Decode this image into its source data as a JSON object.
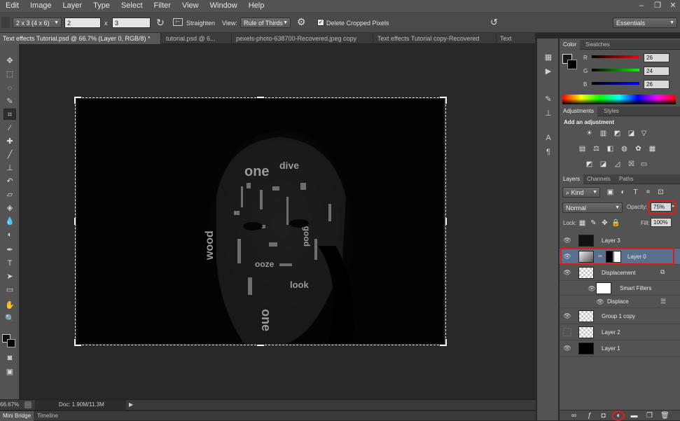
{
  "menu": [
    "Edit",
    "Image",
    "Layer",
    "Type",
    "Select",
    "Filter",
    "View",
    "Window",
    "Help"
  ],
  "options": {
    "ratio_preset": "2 x 3 (4 x 6)",
    "width_value": "2",
    "times_sign": "x",
    "height_value": "3",
    "straighten_label": "Straighten",
    "view_label": "View:",
    "view_value": "Rule of Thirds",
    "delete_cropped_label": "Delete Cropped Pixels",
    "delete_cropped_checked": true,
    "workspace_value": "Essentials"
  },
  "tabs": [
    "Text effects Tutorial.psd @ 66.7% (Layer 0, RGB/8) *",
    "tutorial.psd @ 6...",
    "pexels-photo-638700-Recovered.jpeg copy",
    "Text effects Tutorial copy-Recovered",
    "Text"
  ],
  "artwork_words": [
    "one",
    "wood",
    "dive",
    "look",
    "ooze",
    "agood",
    "one"
  ],
  "status": {
    "zoom": "66.67%",
    "doc": "Doc: 1.90M/11.3M"
  },
  "bottom_tabs": [
    "Mini Bridge",
    "Timeline"
  ],
  "color_panel": {
    "tabs": [
      "Color",
      "Swatches"
    ],
    "r_label": "R",
    "r_value": "26",
    "g_label": "G",
    "g_value": "24",
    "b_label": "B",
    "b_value": "26"
  },
  "adjustments_panel": {
    "tabs": [
      "Adjustments",
      "Styles"
    ],
    "heading": "Add an adjustment"
  },
  "layers_panel": {
    "tabs": [
      "Layers",
      "Channels",
      "Paths"
    ],
    "filter_kind": "Kind",
    "blend_mode": "Normal",
    "opacity_label": "Opacity:",
    "opacity_value": "75%",
    "lock_label": "Lock:",
    "fill_label": "Fill:",
    "fill_value": "100%",
    "layers": [
      {
        "name": "Layer 3",
        "visible": true
      },
      {
        "name": "Layer 0",
        "visible": true,
        "selected": true
      },
      {
        "name": "Displacement",
        "visible": true
      },
      {
        "name": "Smart Filters",
        "visible": true
      },
      {
        "name": "Displace",
        "visible": true
      },
      {
        "name": "Group 1 copy",
        "visible": true
      },
      {
        "name": "Layer 2",
        "visible": false
      },
      {
        "name": "Layer 1",
        "visible": true
      }
    ]
  },
  "colors": {
    "highlight_red": "#e01b1b",
    "panel_bg": "#535353",
    "canvas_bg": "#282828"
  }
}
